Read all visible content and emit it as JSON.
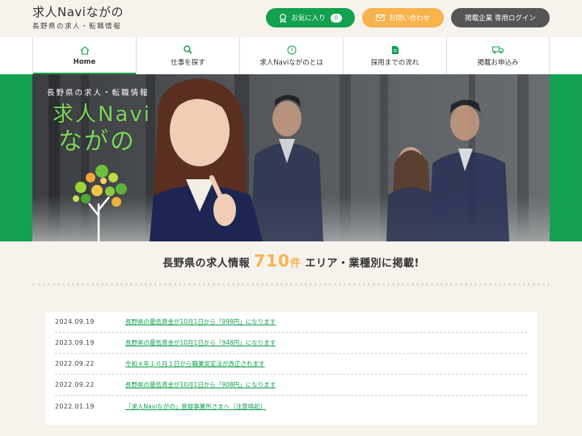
{
  "header": {
    "logo_title": "求人Naviながの",
    "logo_subtitle": "長野県の求人・転職情報",
    "favorites_label": "お気に入り",
    "favorites_count": "0",
    "contact_label": "お問い合わせ",
    "login_label": "掲載企業 専用ログイン"
  },
  "nav": {
    "items": [
      {
        "label": "Home",
        "icon": "home-icon"
      },
      {
        "label": "仕事を探す",
        "icon": "search-icon"
      },
      {
        "label": "求人Naviながのとは",
        "icon": "question-icon"
      },
      {
        "label": "採用までの流れ",
        "icon": "document-icon"
      },
      {
        "label": "掲載お申込み",
        "icon": "truck-icon"
      }
    ]
  },
  "hero": {
    "subtitle": "長野県の求人・転職情報",
    "title_line1": "求人Navi",
    "title_line2": "ながの"
  },
  "summary": {
    "prefix": "長野県の求人情報",
    "count": "710",
    "unit": "件",
    "suffix": "エリア・業種別に掲載!"
  },
  "news": [
    {
      "date": "2024.09.19",
      "title": "長野県の最低賃金が10月1日から「998円」になります"
    },
    {
      "date": "2023.09.19",
      "title": "長野県の最低賃金が10月1日から「948円」になります"
    },
    {
      "date": "2022.09.22",
      "title": "令和４年１０月１日から職業安定法が改正されます"
    },
    {
      "date": "2022.09.22",
      "title": "長野県の最低賃金が10月1日から「908円」になります"
    },
    {
      "date": "2022.01.19",
      "title": "「求人Naviながの」登録事業所さまへ（注意喚起）"
    }
  ],
  "colors": {
    "brand_green": "#13a04f",
    "accent_orange": "#f7b34c",
    "dark_button": "#555555",
    "page_background": "#f6f2ec"
  }
}
